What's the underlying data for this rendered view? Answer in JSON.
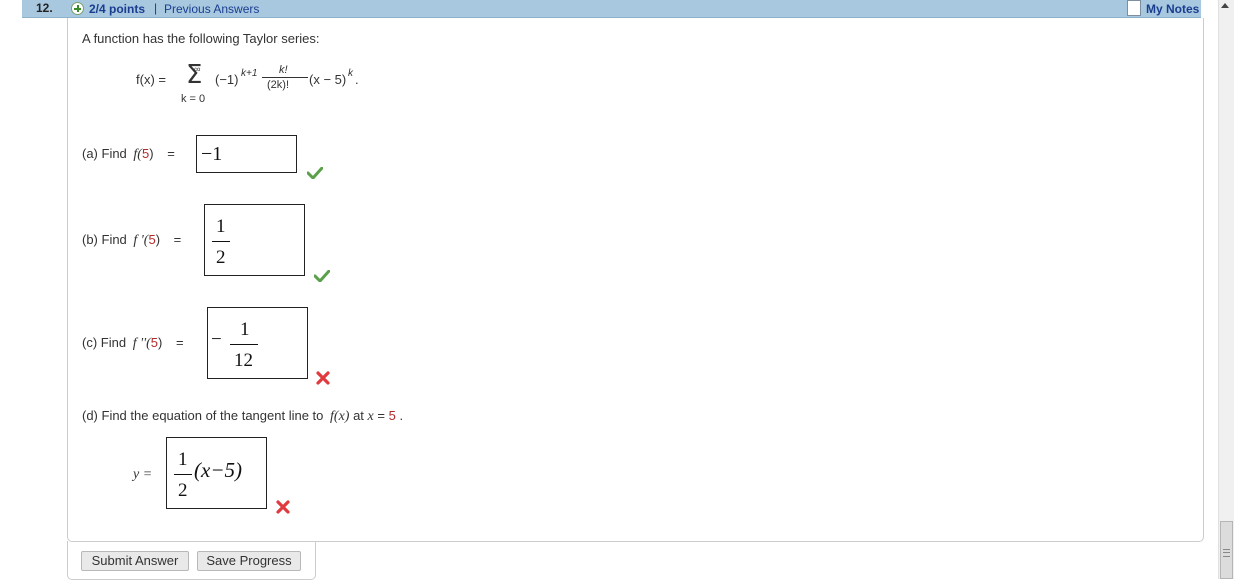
{
  "header": {
    "question_number": "12.",
    "points": "2/4 points",
    "separator": "|",
    "previous_answers": "Previous Answers",
    "my_notes": "My Notes"
  },
  "intro": "A function has the following Taylor series:",
  "formula": {
    "lhs": "f(x) =",
    "sigma": "Σ",
    "upper_limit": "∞",
    "lower_limit": "k = 0",
    "sign_term": "(−1)",
    "sign_exponent": "k+1",
    "coef_num": "k!",
    "coef_den": "(2k)!",
    "power_base": "(x − 5)",
    "power_exponent": "k",
    "end": "."
  },
  "parts": {
    "a": {
      "prefix": "(a)  Find",
      "func": "f(",
      "arg": "5",
      "close": ")",
      "equals": "=",
      "answer": "−1",
      "status": "correct"
    },
    "b": {
      "prefix": "(b)  Find",
      "func": "f '(",
      "arg": "5",
      "close": ")",
      "equals": "=",
      "answer_num": "1",
      "answer_den": "2",
      "status": "correct"
    },
    "c": {
      "prefix": "(c)  Find",
      "func": "f ''(",
      "arg": "5",
      "close": ")",
      "equals": "=",
      "answer_sign": "−",
      "answer_num": "1",
      "answer_den": "12",
      "status": "incorrect"
    },
    "d": {
      "prefix": "(d)  Find the equation of the tangent line to",
      "func": "f(x)",
      "at": "at",
      "var": "x",
      "eq": "=",
      "value": "5",
      "period": ".",
      "lhs": "y =",
      "answer_num": "1",
      "answer_den": "2",
      "answer_tail": "(x−5)",
      "status": "incorrect"
    }
  },
  "buttons": {
    "submit": "Submit Answer",
    "save": "Save Progress"
  },
  "colors": {
    "header_bg": "#a8c8e0",
    "link": "#1a3d8f",
    "correct": "#5aa04a",
    "incorrect": "#e0393e",
    "highlight_number": "#b22a2a"
  }
}
